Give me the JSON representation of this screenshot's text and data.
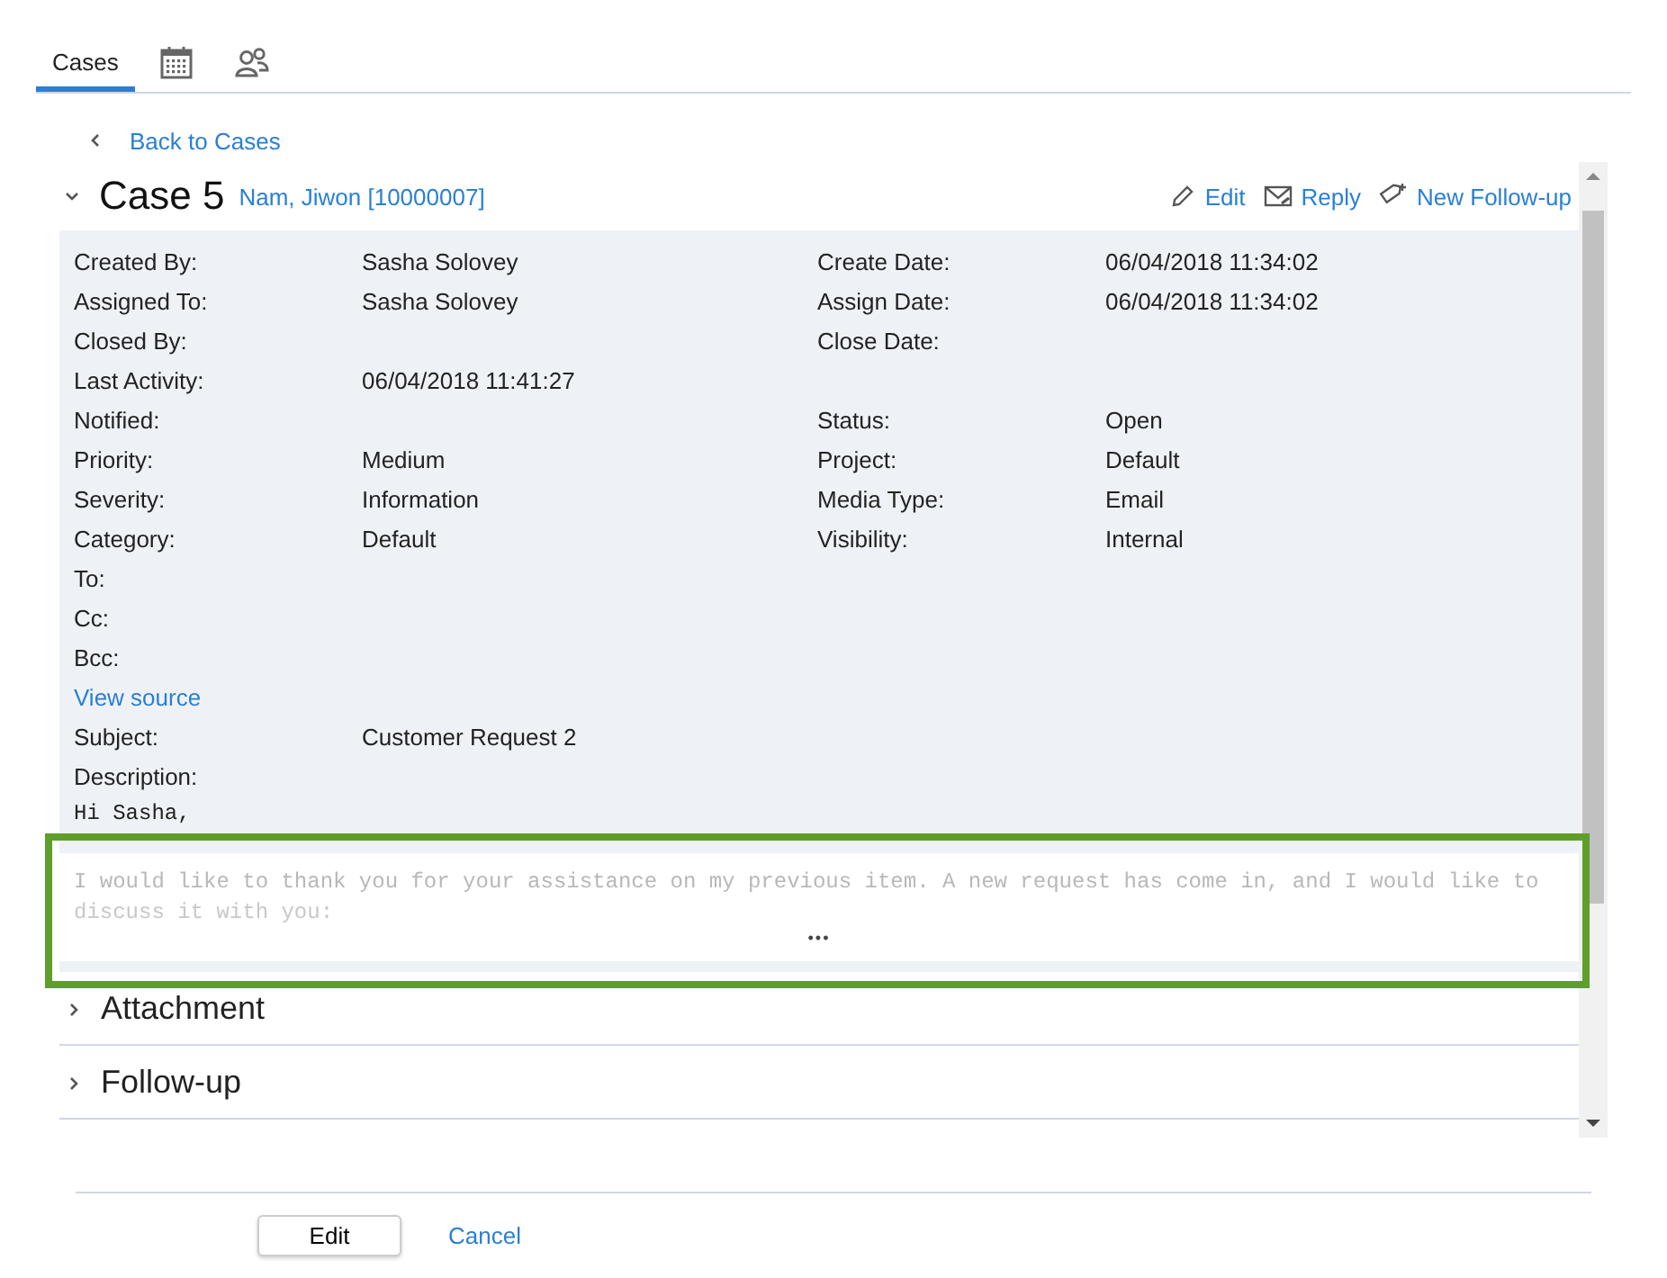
{
  "tabs": [
    {
      "kind": "text",
      "label": "Cases",
      "selected": true
    },
    {
      "kind": "calendar",
      "selected": false
    },
    {
      "kind": "people",
      "selected": false
    }
  ],
  "back_link": "Back to Cases",
  "case": {
    "title": "Case 5",
    "contact": "Nam, Jiwon [10000007]",
    "expanded": true,
    "actions": [
      {
        "kind": "edit",
        "label": "Edit"
      },
      {
        "kind": "reply",
        "label": "Reply"
      },
      {
        "kind": "follow-up",
        "label": "New Follow-up"
      }
    ]
  },
  "fields": [
    {
      "kind": "field",
      "label": "Created By:",
      "value": "Sasha Solovey",
      "label_2": "Create Date:",
      "value_2": "06/04/2018 11:34:02"
    },
    {
      "kind": "field",
      "label": "Assigned To:",
      "value": "Sasha Solovey",
      "label_2": "Assign Date:",
      "value_2": "06/04/2018 11:34:02"
    },
    {
      "kind": "field",
      "label": "Closed By:",
      "label_2": "Close Date:"
    },
    {
      "kind": "field",
      "label": "Last Activity:",
      "value": "06/04/2018 11:41:27"
    },
    {
      "kind": "field",
      "label": "Notified:",
      "label_2": "Status:",
      "value_2": "Open"
    },
    {
      "kind": "field",
      "label": "Priority:",
      "value": "Medium",
      "label_2": "Project:",
      "value_2": "Default"
    },
    {
      "kind": "field",
      "label": "Severity:",
      "value": "Information",
      "label_2": "Media Type:",
      "value_2": "Email"
    },
    {
      "kind": "field",
      "label": "Category:",
      "value": "Default",
      "label_2": "Visibility:",
      "value_2": "Internal"
    },
    {
      "kind": "field",
      "label": "To:"
    },
    {
      "kind": "field",
      "label": "Cc:"
    },
    {
      "kind": "field",
      "label": "Bcc:"
    },
    {
      "kind": "link",
      "label": "View source"
    },
    {
      "kind": "field",
      "label": "Subject:",
      "value": "Customer Request 2"
    },
    {
      "kind": "field",
      "label": "Description:"
    }
  ],
  "description": {
    "greeting": "Hi Sasha,",
    "body": "I would like to thank you for your assistance on my previous item. A new request has come in, and I would like to",
    "faded": "discuss it with you:",
    "more": "•••"
  },
  "sections": [
    {
      "title": "Attachment",
      "expanded": false
    },
    {
      "title": "Follow-up",
      "expanded": false
    }
  ],
  "buttons": [
    {
      "kind": "primary",
      "label": "Edit"
    },
    {
      "kind": "link",
      "label": "Cancel"
    }
  ]
}
